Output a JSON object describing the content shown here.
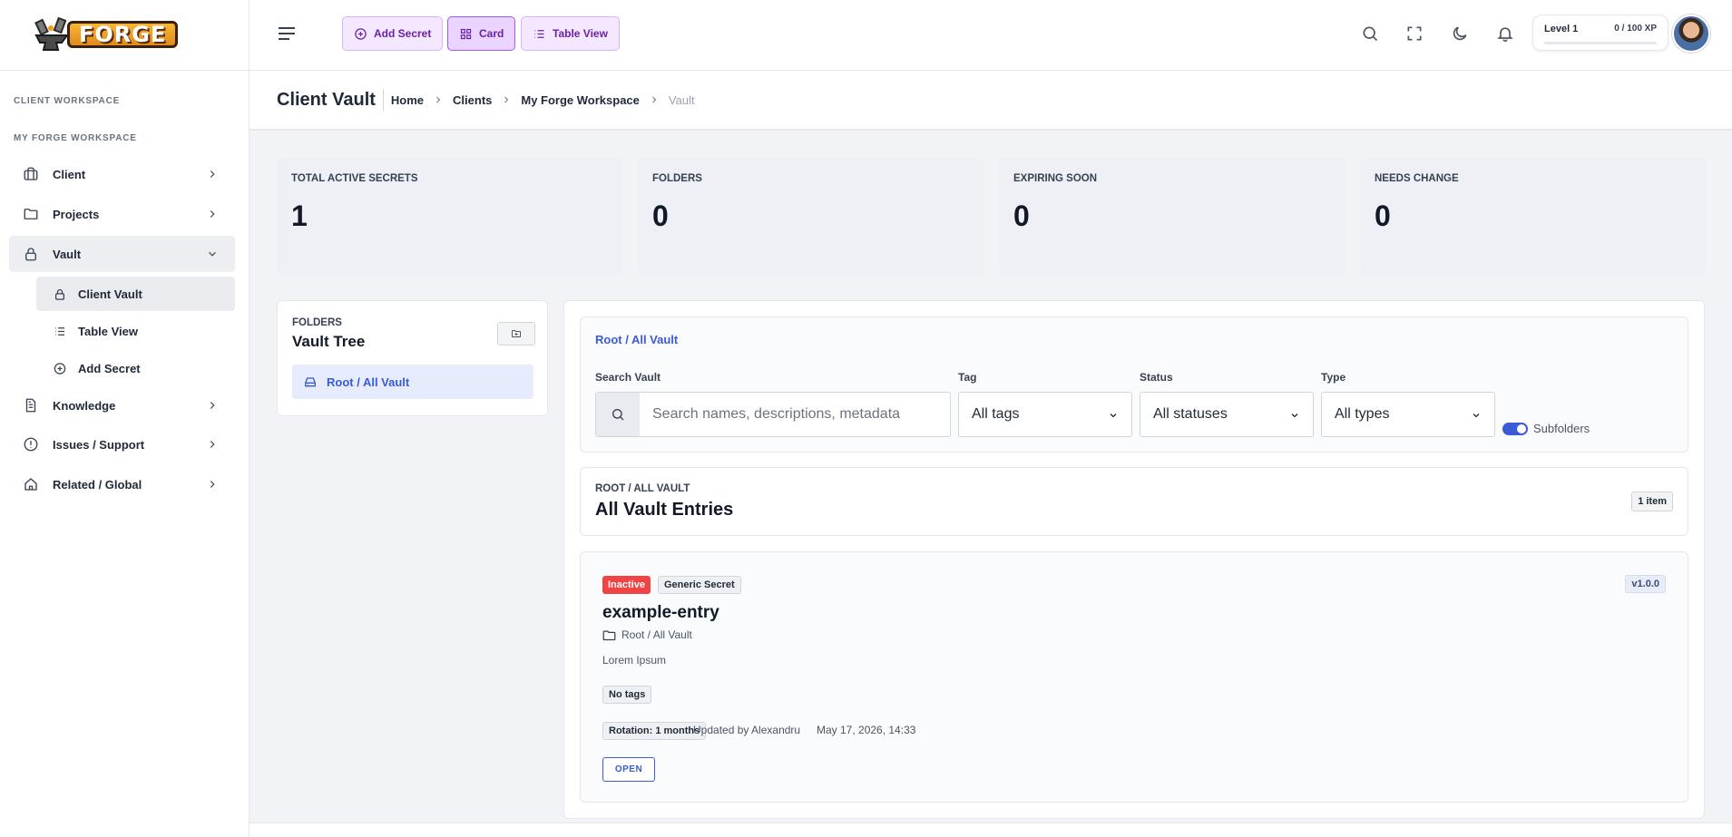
{
  "brand": {
    "name": "FORGE"
  },
  "sidebar": {
    "section_client": "CLIENT WORKSPACE",
    "section_workspace": "MY FORGE WORKSPACE",
    "items": {
      "client": "Client",
      "projects": "Projects",
      "vault": "Vault",
      "knowledge": "Knowledge",
      "issues": "Issues / Support",
      "related": "Related / Global"
    },
    "vault_sub": {
      "client_vault": "Client Vault",
      "table_view": "Table View",
      "add_secret": "Add Secret"
    }
  },
  "toolbar": {
    "add_secret": "Add Secret",
    "card": "Card",
    "table_view": "Table View"
  },
  "xp": {
    "level": "Level 1",
    "value": "0 / 100 XP",
    "progress_fraction": 0
  },
  "header": {
    "title": "Client Vault",
    "breadcrumb": [
      "Home",
      "Clients",
      "My Forge Workspace",
      "Vault"
    ]
  },
  "stats": [
    {
      "label": "TOTAL ACTIVE SECRETS",
      "value": "1"
    },
    {
      "label": "FOLDERS",
      "value": "0"
    },
    {
      "label": "EXPIRING SOON",
      "value": "0"
    },
    {
      "label": "NEEDS CHANGE",
      "value": "0"
    }
  ],
  "folders": {
    "label": "FOLDERS",
    "title": "Vault Tree",
    "root": "Root / All Vault"
  },
  "filters": {
    "path": "Root / All Vault",
    "search_label": "Search Vault",
    "search_placeholder": "Search names, descriptions, metadata",
    "tag_label": "Tag",
    "tag_value": "All tags",
    "status_label": "Status",
    "status_value": "All statuses",
    "type_label": "Type",
    "type_value": "All types",
    "subfolders_label": "Subfolders",
    "subfolders_on": true
  },
  "entries_section": {
    "crumb": "ROOT / ALL VAULT",
    "title": "All Vault Entries",
    "count": "1 item"
  },
  "entry": {
    "status": "Inactive",
    "type": "Generic Secret",
    "version": "v1.0.0",
    "name": "example-entry",
    "path": "Root / All Vault",
    "description": "Lorem Ipsum",
    "tags": "No tags",
    "rotation": "Rotation: 1 months",
    "updated_by": "Updated by Alexandru",
    "updated_at": "May 17, 2026, 14:33",
    "open_label": "OPEN"
  },
  "colors": {
    "accent": "#3b5bd6",
    "toolbar_purple": "#6b21a8",
    "inactive_red": "#ef4444"
  }
}
